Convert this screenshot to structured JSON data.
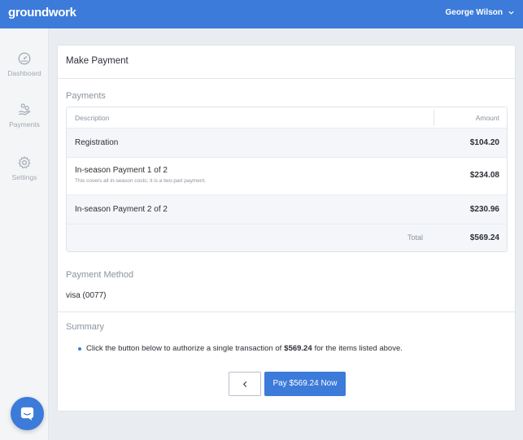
{
  "app": {
    "logo_text": "groundwork"
  },
  "header": {
    "user_name": "George Wilson"
  },
  "sidebar": {
    "items": [
      {
        "label": "Dashboard",
        "icon": "gauge-icon"
      },
      {
        "label": "Payments",
        "icon": "hand-coins-icon"
      },
      {
        "label": "Settings",
        "icon": "gear-icon"
      }
    ]
  },
  "page": {
    "title": "Make Payment"
  },
  "payments": {
    "section_title": "Payments",
    "columns": [
      "Description",
      "Amount"
    ],
    "rows": [
      {
        "description": "Registration",
        "note": "",
        "amount": "$104.20"
      },
      {
        "description": "In-season Payment 1 of 2",
        "note": "This covers all in-season costs; it is a two-part payment.",
        "amount": "$234.08"
      },
      {
        "description": "In-season Payment 2 of 2",
        "note": "",
        "amount": "$230.96"
      }
    ],
    "total_label": "Total",
    "total_amount": "$569.24"
  },
  "payment_method": {
    "section_title": "Payment Method",
    "value": "visa (0077)"
  },
  "summary": {
    "section_title": "Summary",
    "text_before": "Click the button below to authorize a single transaction of",
    "amount": "$569.24",
    "text_after": "for the items listed above."
  },
  "actions": {
    "pay_label": "Pay $569.24 Now"
  },
  "colors": {
    "brand": "#3c7bd9",
    "muted": "#8a939e"
  }
}
